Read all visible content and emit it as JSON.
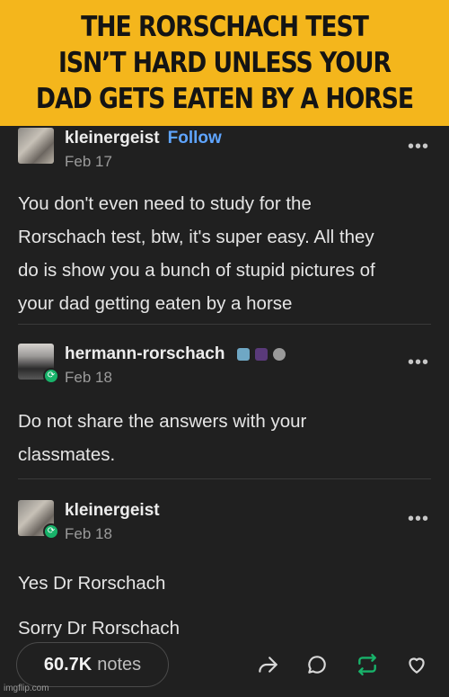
{
  "caption": {
    "line1": "THE RORSCHACH TEST",
    "line2": "ISN’T HARD UNLESS YOUR",
    "line3": "DAD GETS EATEN BY A HORSE"
  },
  "posts": [
    {
      "username": "kleinergeist",
      "follow_label": "Follow",
      "date": "Feb 17",
      "menu": "•••",
      "lines": [
        "You don't even need to study for the",
        "Rorschach test, btw, it's super easy. All they",
        "do is show you a bunch of stupid pictures of",
        "your dad getting eaten by a horse"
      ]
    },
    {
      "username": "hermann-rorschach",
      "date": "Feb 18",
      "menu": "•••",
      "lines": [
        "Do not share the answers with your",
        "classmates."
      ]
    },
    {
      "username": "kleinergeist",
      "date": "Feb 18",
      "menu": "•••",
      "lines": [
        "Yes Dr Rorschach",
        "Sorry Dr Rorschach"
      ]
    }
  ],
  "footer": {
    "notes_count": "60.7K",
    "notes_label": "notes",
    "icons": [
      "share-icon",
      "comment-icon",
      "reblog-icon",
      "like-icon"
    ],
    "reblog_color": "#18b36a"
  },
  "watermark": "imgflip.com",
  "colors": {
    "caption_bg": "#f4b61c",
    "background": "#202020",
    "follow": "#5fa5ff"
  }
}
